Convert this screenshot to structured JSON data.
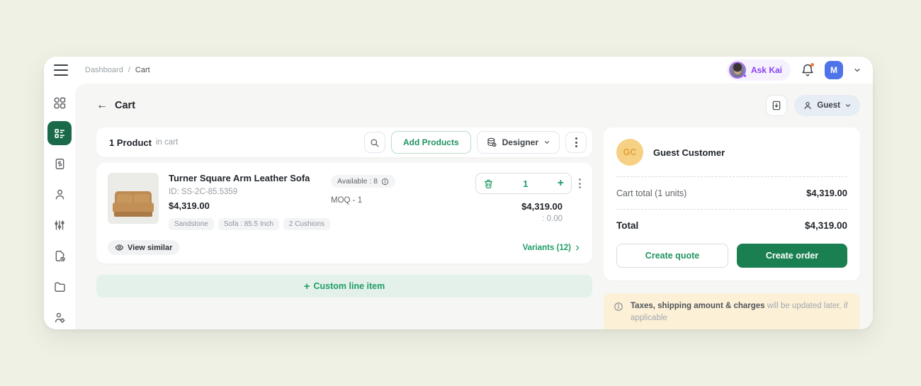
{
  "topbar": {
    "breadcrumb": {
      "root": "Dashboard",
      "separator": "/",
      "current": "Cart"
    },
    "ask_kai_label": "Ask Kai",
    "user_initial": "M"
  },
  "page": {
    "title": "Cart",
    "customer_dropdown_label": "Guest"
  },
  "cart_header": {
    "count_label": "1 Product",
    "count_suffix": "in cart",
    "add_products_label": "Add Products",
    "designer_label": "Designer"
  },
  "product": {
    "name": "Turner Square Arm Leather Sofa",
    "id": "ID: SS-2C-85.5359",
    "price": "$4,319.00",
    "tags": [
      "Sandstone",
      "Sofa : 85.5 Inch",
      "2 Cushions"
    ],
    "available_label": "Available : 8",
    "moq_label": "MOQ - 1",
    "quantity": "1",
    "line_total": "$4,319.00",
    "line_sub": ": 0.00",
    "view_similar_label": "View similar",
    "variants_label": "Variants (12)"
  },
  "custom_line_item": {
    "label": "Custom line item"
  },
  "summary": {
    "avatar_initials": "GC",
    "customer_name": "Guest Customer",
    "cart_total_label": "Cart total (1 units)",
    "cart_total_value": "$4,319.00",
    "total_label": "Total",
    "total_value": "$4,319.00",
    "create_quote_label": "Create quote",
    "create_order_label": "Create order"
  },
  "tax_note": {
    "bold": "Taxes, shipping amount & charges",
    "rest": " will be updated later, if applicable"
  },
  "icons": {
    "plus": "+",
    "chevron_down": "⌄",
    "chevron_right": "›",
    "back_arrow": "←",
    "sparkle": "✦"
  },
  "colors": {
    "accent_green": "#1f9d66",
    "button_green": "#1a7f51",
    "sidebar_active_green": "#1a6a49",
    "ask_kai_purple": "#8b3ff5",
    "user_avatar_blue": "#4f74ea",
    "gc_avatar_yellow": "#f6d183",
    "note_banner_cream": "#fcf0d6",
    "page_background": "#f0f1e5"
  }
}
